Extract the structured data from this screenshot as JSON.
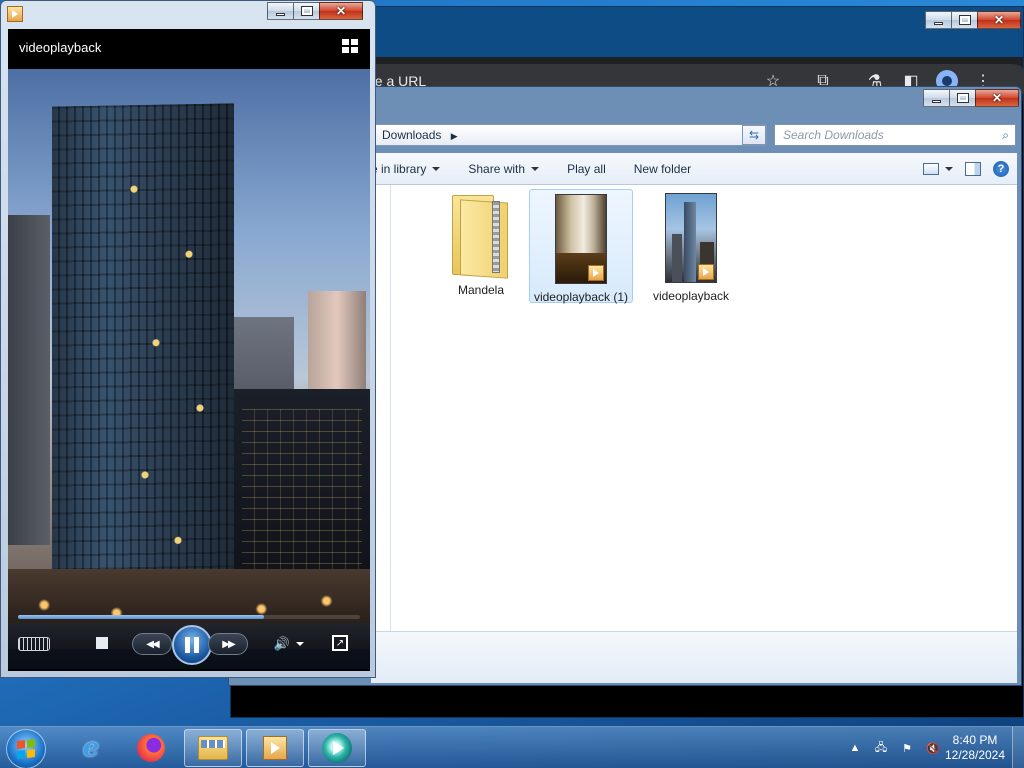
{
  "chrome": {
    "omnibox_text": "pe a URL",
    "icons": [
      "star-icon",
      "extensions-icon",
      "labs-icon",
      "side-panel-icon",
      "profile-icon",
      "more-icon"
    ]
  },
  "explorer": {
    "breadcrumb": "Downloads",
    "search_placeholder": "Search Downloads",
    "commands": [
      "e in library",
      "Share with",
      "Play all",
      "New folder"
    ],
    "files": [
      {
        "name": "Mandela",
        "type": "zip-folder",
        "selected": false
      },
      {
        "name": "videoplayback (1)",
        "type": "video",
        "selected": true
      },
      {
        "name": "videoplayback",
        "type": "video",
        "selected": false
      }
    ]
  },
  "player": {
    "title": "videoplayback",
    "progress": 0.72,
    "state": "playing"
  },
  "taskbar": {
    "pinned": [
      "ie-icon",
      "firefox-icon",
      "explorer-icon",
      "media-player-icon",
      "media-center-icon"
    ],
    "active": [
      "explorer-icon",
      "media-player-icon",
      "media-center-icon"
    ],
    "tray": [
      "network-icon",
      "action-center-flag-icon",
      "volume-muted-icon"
    ],
    "time": "8:40 PM",
    "date": "12/28/2024"
  },
  "colors": {
    "desktop": "#1d6fbf",
    "accent": "#1f5da6"
  }
}
